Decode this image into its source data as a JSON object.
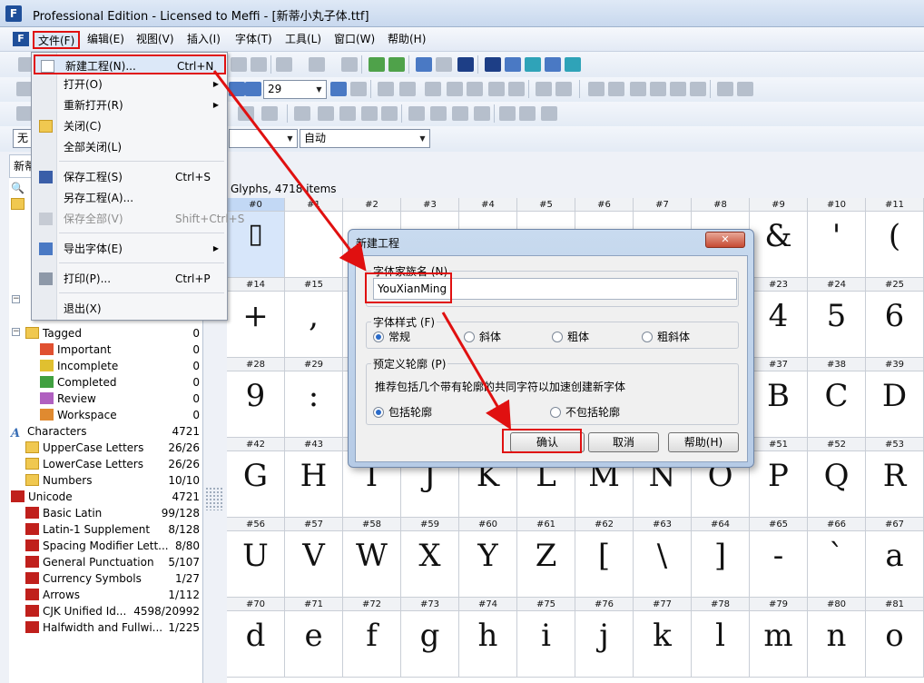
{
  "window": {
    "title": "Professional Edition - Licensed to Meffi - [新蒂小丸子体.ttf]"
  },
  "menubar": [
    "文件(F)",
    "编辑(E)",
    "视图(V)",
    "插入(I)",
    "字体(T)",
    "工具(L)",
    "窗口(W)",
    "帮助(H)"
  ],
  "toolbar": {
    "zoom_value": "29",
    "mode_value": "自动",
    "left_combo_value": "无"
  },
  "file_menu": {
    "items": [
      {
        "label": "新建工程(N)...",
        "shortcut": "Ctrl+N"
      },
      {
        "label": "打开(O)",
        "shortcut": ""
      },
      {
        "label": "重新打开(R)",
        "shortcut": ""
      },
      {
        "label": "关闭(C)",
        "shortcut": ""
      },
      {
        "label": "全部关闭(L)",
        "shortcut": ""
      },
      {
        "label": "保存工程(S)",
        "shortcut": "Ctrl+S"
      },
      {
        "label": "另存工程(A)...",
        "shortcut": ""
      },
      {
        "label": "保存全部(V)",
        "shortcut": "Shift+Ctrl+S"
      },
      {
        "label": "导出字体(E)",
        "shortcut": ""
      },
      {
        "label": "打印(P)...",
        "shortcut": "Ctrl+P"
      },
      {
        "label": "退出(X)",
        "shortcut": ""
      }
    ]
  },
  "left_panel": {
    "tab_label": "新蒂",
    "tagged": {
      "label": "Tagged",
      "count": "0"
    },
    "flags": [
      {
        "label": "Important",
        "count": "0"
      },
      {
        "label": "Incomplete",
        "count": "0"
      },
      {
        "label": "Completed",
        "count": "0"
      },
      {
        "label": "Review",
        "count": "0"
      },
      {
        "label": "Workspace",
        "count": "0"
      }
    ],
    "characters": {
      "label": "Characters",
      "count": "4721"
    },
    "char_groups": [
      {
        "label": "UpperCase Letters",
        "count": "26/26"
      },
      {
        "label": "LowerCase Letters",
        "count": "26/26"
      },
      {
        "label": "Numbers",
        "count": "10/10"
      }
    ],
    "unicode": {
      "label": "Unicode",
      "count": "4721"
    },
    "unicode_blocks": [
      {
        "label": "Basic Latin",
        "count": "99/128"
      },
      {
        "label": "Latin-1 Supplement",
        "count": "8/128"
      },
      {
        "label": "Spacing Modifier Lett...",
        "count": "8/80"
      },
      {
        "label": "General Punctuation",
        "count": "5/107"
      },
      {
        "label": "Currency Symbols",
        "count": "1/27"
      },
      {
        "label": "Arrows",
        "count": "1/112"
      },
      {
        "label": "CJK Unified Id...",
        "count": "4598/20992"
      },
      {
        "label": "Halfwidth and Fullwi...",
        "count": "1/225"
      }
    ]
  },
  "glyph_panel": {
    "header": "Glyphs, 4718 items",
    "rows": [
      [
        {
          "n": "#0",
          "g": "▯"
        },
        {
          "n": "#1",
          "g": ""
        },
        {
          "n": "#2",
          "g": ""
        },
        {
          "n": "#3",
          "g": ""
        },
        {
          "n": "#4",
          "g": ""
        },
        {
          "n": "#5",
          "g": ""
        },
        {
          "n": "#6",
          "g": ""
        },
        {
          "n": "#7",
          "g": ""
        },
        {
          "n": "#8",
          "g": ""
        },
        {
          "n": "#9",
          "g": "&"
        },
        {
          "n": "#10",
          "g": "'"
        },
        {
          "n": "#11",
          "g": "("
        }
      ],
      [
        {
          "n": "#14",
          "g": "+"
        },
        {
          "n": "#15",
          "g": ","
        },
        {
          "n": "",
          "g": ""
        },
        {
          "n": "",
          "g": ""
        },
        {
          "n": "",
          "g": ""
        },
        {
          "n": "",
          "g": ""
        },
        {
          "n": "",
          "g": ""
        },
        {
          "n": "",
          "g": ""
        },
        {
          "n": "",
          "g": ""
        },
        {
          "n": "#23",
          "g": "4"
        },
        {
          "n": "#24",
          "g": "5"
        },
        {
          "n": "#25",
          "g": "6"
        }
      ],
      [
        {
          "n": "#28",
          "g": "9"
        },
        {
          "n": "#29",
          "g": ":"
        },
        {
          "n": "",
          "g": ""
        },
        {
          "n": "",
          "g": ""
        },
        {
          "n": "",
          "g": ""
        },
        {
          "n": "",
          "g": ""
        },
        {
          "n": "",
          "g": ""
        },
        {
          "n": "",
          "g": ""
        },
        {
          "n": "",
          "g": ""
        },
        {
          "n": "#37",
          "g": "B"
        },
        {
          "n": "#38",
          "g": "C"
        },
        {
          "n": "#39",
          "g": "D"
        }
      ],
      [
        {
          "n": "#42",
          "g": "G"
        },
        {
          "n": "#43",
          "g": "H"
        },
        {
          "n": "",
          "g": "I"
        },
        {
          "n": "",
          "g": "J"
        },
        {
          "n": "",
          "g": "K"
        },
        {
          "n": "",
          "g": "L"
        },
        {
          "n": "",
          "g": "M"
        },
        {
          "n": "",
          "g": "N"
        },
        {
          "n": "",
          "g": "O"
        },
        {
          "n": "#51",
          "g": "P"
        },
        {
          "n": "#52",
          "g": "Q"
        },
        {
          "n": "#53",
          "g": "R"
        }
      ],
      [
        {
          "n": "#56",
          "g": "U"
        },
        {
          "n": "#57",
          "g": "V"
        },
        {
          "n": "#58",
          "g": "W"
        },
        {
          "n": "#59",
          "g": "X"
        },
        {
          "n": "#60",
          "g": "Y"
        },
        {
          "n": "#61",
          "g": "Z"
        },
        {
          "n": "#62",
          "g": "["
        },
        {
          "n": "#63",
          "g": "\\"
        },
        {
          "n": "#64",
          "g": "]"
        },
        {
          "n": "#65",
          "g": "-"
        },
        {
          "n": "#66",
          "g": "`"
        },
        {
          "n": "#67",
          "g": "a"
        }
      ],
      [
        {
          "n": "#70",
          "g": "d"
        },
        {
          "n": "#71",
          "g": "e"
        },
        {
          "n": "#72",
          "g": "f"
        },
        {
          "n": "#73",
          "g": "g"
        },
        {
          "n": "#74",
          "g": "h"
        },
        {
          "n": "#75",
          "g": "i"
        },
        {
          "n": "#76",
          "g": "j"
        },
        {
          "n": "#77",
          "g": "k"
        },
        {
          "n": "#78",
          "g": "l"
        },
        {
          "n": "#79",
          "g": "m"
        },
        {
          "n": "#80",
          "g": "n"
        },
        {
          "n": "#81",
          "g": "o"
        }
      ]
    ]
  },
  "dialog": {
    "title": "新建工程",
    "family_label": "字体家族名 (N)",
    "family_value": "YouXianMing",
    "style_label": "字体样式 (F)",
    "styles": [
      "常规",
      "斜体",
      "粗体",
      "粗斜体"
    ],
    "outline_label": "预定义轮廓 (P)",
    "outline_desc": "推荐包括几个带有轮廓的共同字符以加速创建新字体",
    "outline_options": [
      "包括轮廓",
      "不包括轮廓"
    ],
    "buttons": {
      "ok": "确认",
      "cancel": "取消",
      "help": "帮助(H)"
    },
    "close_glyph": "✕"
  },
  "colors": {
    "annotation_red": "#e01010",
    "selection_blue": "#d7e6fa"
  }
}
